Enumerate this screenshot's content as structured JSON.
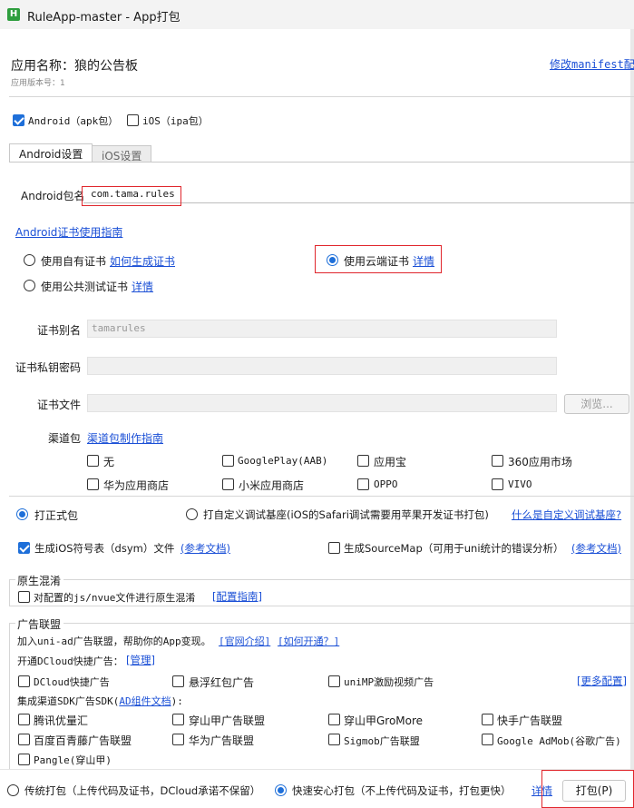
{
  "window": {
    "title": "RuleApp-master - App打包",
    "icon_letter": "H"
  },
  "header": {
    "app_name": "应用名称：狼的公告板",
    "version_label": "应用版本号：1",
    "manifest_link": "修改manifest配置"
  },
  "platforms": {
    "android": {
      "label": "Android（apk包）",
      "checked": true
    },
    "ios": {
      "label": "iOS（ipa包）",
      "checked": false
    }
  },
  "tabs": [
    {
      "label": "Android设置",
      "active": true
    },
    {
      "label": "iOS设置",
      "active": false
    }
  ],
  "android": {
    "package_label": "Android包名",
    "package_value": "com.tama.rules",
    "cert_guide_link": "Android证书使用指南",
    "cert_own": {
      "label": "使用自有证书",
      "link": "如何生成证书",
      "selected": false
    },
    "cert_public": {
      "label": "使用公共测试证书",
      "link": "详情",
      "selected": false
    },
    "cert_cloud": {
      "label": "使用云端证书",
      "link": "详情",
      "selected": true
    },
    "alias_label": "证书别名",
    "alias_value": "tamarules",
    "key_password_label": "证书私钥密码",
    "cert_file_label": "证书文件",
    "browse_button": "浏览...",
    "channel_label": "渠道包",
    "channel_guide_link": "渠道包制作指南",
    "channels": [
      [
        "无",
        "GooglePlay(AAB)",
        "应用宝",
        "360应用市场"
      ],
      [
        "华为应用商店",
        "小米应用商店",
        "OPPO",
        "VIVO"
      ]
    ]
  },
  "build_type": {
    "formal": {
      "label": "打正式包",
      "selected": true
    },
    "custom_base": {
      "label": "打自定义调试基座(iOS的Safari调试需要用苹果开发证书打包)",
      "selected": false
    },
    "custom_base_link": "什么是自定义调试基座?"
  },
  "symbols": {
    "ios_dsym": {
      "label": "生成iOS符号表（dsym）文件",
      "checked": true,
      "link": "(参考文档)"
    },
    "sourcemap": {
      "label": "生成SourceMap（可用于uni统计的错误分析）",
      "checked": false,
      "link": "(参考文档)"
    }
  },
  "native_obfuscation": {
    "title": "原生混淆",
    "option": "对配置的js/nvue文件进行原生混淆",
    "link": "[配置指南]"
  },
  "ads": {
    "title": "广告联盟",
    "intro": "加入uni-ad广告联盟，帮助你的App变现。",
    "intro_link1": "[官网介绍]",
    "intro_link2": "[如何开通？]",
    "dcloud_label": "开通DCloud快捷广告：",
    "dcloud_manage_link": "[管理]",
    "dcloud_options": [
      "DCloud快捷广告",
      "悬浮红包广告",
      "uniMP激励视频广告"
    ],
    "more_link": "[更多配置]",
    "sdk_label": "集成渠道SDK广告SDK(",
    "sdk_link": "AD组件文档",
    "sdk_label_tail": "):",
    "sdk_options": [
      [
        "腾讯优量汇",
        "穿山甲广告联盟",
        "穿山甲GroMore",
        "快手广告联盟"
      ],
      [
        "百度百青藤广告联盟",
        "华为广告联盟",
        "Sigmob广告联盟",
        "Google AdMob(谷歌广告)"
      ],
      [
        "Pangle(穿山甲)"
      ]
    ]
  },
  "bottom": {
    "traditional": {
      "label": "传统打包（上传代码及证书，DCloud承诺不保留）",
      "selected": false
    },
    "fast": {
      "label": "快速安心打包（不上传代码及证书，打包更快）",
      "selected": true
    },
    "details_link": "详情",
    "pack_button": "打包(P)"
  },
  "colors": {
    "accent": "#1e6fd9",
    "link": "#1a4fd6",
    "highlight_box": "#e0262c"
  }
}
